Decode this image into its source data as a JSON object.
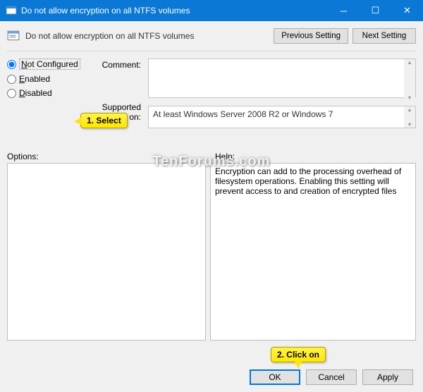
{
  "titlebar": {
    "title": "Do not allow encryption on all NTFS volumes"
  },
  "header": {
    "title": "Do not allow encryption on all NTFS volumes",
    "previous": "Previous Setting",
    "next": "Next Setting"
  },
  "radios": {
    "not_configured": "Not Configured",
    "enabled": "Enabled",
    "disabled": "Disabled"
  },
  "labels": {
    "comment": "Comment:",
    "supported": "Supported on:",
    "options": "Options:",
    "help": "Help:"
  },
  "supported_on": "At least Windows Server 2008 R2 or Windows 7",
  "help_text": "Encryption can add to the processing overhead of filesystem operations.  Enabling this setting will prevent access to and creation of encrypted files",
  "footer": {
    "ok": "OK",
    "cancel": "Cancel",
    "apply": "Apply"
  },
  "callouts": {
    "select": "1. Select",
    "click": "2. Click on"
  },
  "watermark": "TenForums.com"
}
